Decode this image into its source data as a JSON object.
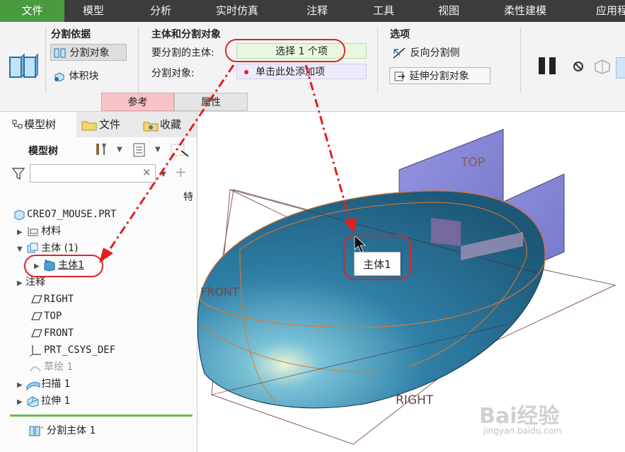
{
  "menu": {
    "items": [
      "文件",
      "模型",
      "分析",
      "实时仿真",
      "注释",
      "工具",
      "视图",
      "柔性建模",
      "应用程"
    ]
  },
  "ribbon": {
    "split_basis_label": "分割依据",
    "split_object_btn": "分割对象",
    "volume_block_btn": "体积块",
    "bodies_group_label": "主体和分割对象",
    "body_to_split_label": "要分割的主体:",
    "body_to_split_value": "选择 1 个项",
    "split_object_label": "分割对象:",
    "split_object_value": "单击此处添加项",
    "options_label": "选项",
    "flip_side_btn": "反向分割侧",
    "extend_object_btn": "延伸分割对象",
    "tab_references": "参考",
    "tab_properties": "属性"
  },
  "sidebar": {
    "tabs": [
      "模型树",
      "文件",
      "收藏"
    ],
    "tree_title": "模型树",
    "filter_placeholder": "",
    "column_hint": "特",
    "root": "CREO7_MOUSE.PRT",
    "items": {
      "materials": "材料",
      "bodies": "主体 (1)",
      "body1": "主体1",
      "annotations": "注释",
      "right": "RIGHT",
      "top": "TOP",
      "front": "FRONT",
      "csys": "PRT_CSYS_DEF",
      "sketch": "草绘 1",
      "sweep": "扫描 1",
      "extrude": "拉伸 1",
      "split_body": "分割主体 1"
    }
  },
  "viewport": {
    "label_top": "TOP",
    "label_front": "FRONT",
    "label_right": "RIGHT",
    "tooltip": "主体1"
  },
  "watermark": {
    "brand": "Bai经验",
    "url": "jingyan.baidu.com"
  },
  "colors": {
    "menu_bg": "#3c3c3c",
    "file_tab": "#4a9a3f",
    "callout_red": "#d9262b",
    "body_blue": "#2f7fa6",
    "edge_orange": "#e0782d",
    "plane_purple": "#7f7fd2"
  }
}
